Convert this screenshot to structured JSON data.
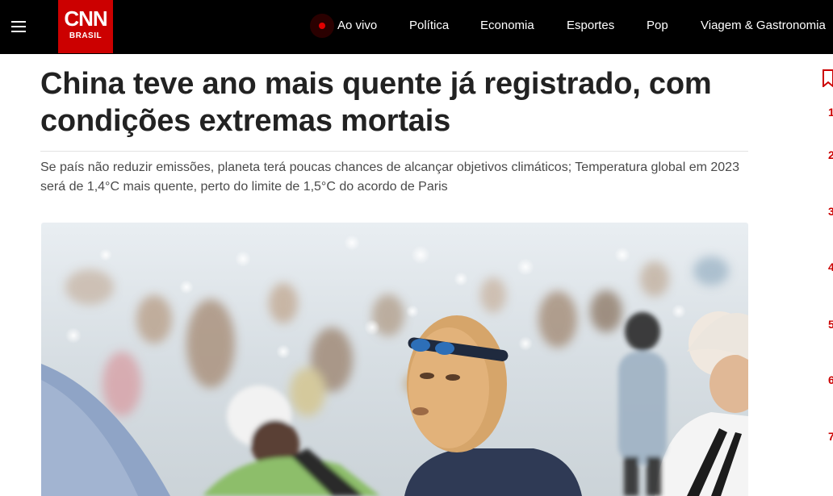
{
  "header": {
    "logo_text": "CNN",
    "logo_sub": "BRASIL",
    "nav": [
      {
        "label": "Ao vivo"
      },
      {
        "label": "Política"
      },
      {
        "label": "Economia"
      },
      {
        "label": "Esportes"
      },
      {
        "label": "Pop"
      },
      {
        "label": "Viagem & Gastronomia"
      }
    ]
  },
  "article": {
    "title": "China teve ano mais quente já registrado, com condições extremas mortais",
    "subtitle": "Se país não reduzir emissões, planeta terá poucas chances de alcançar objetivos climáticos; Temperatura global em 2023 será de 1,4°C mais quente, perto do limite de 1,5°C do acordo de Paris"
  },
  "rail": {
    "numbers": [
      "1",
      "2",
      "3",
      "4",
      "5",
      "6",
      "7"
    ]
  },
  "colors": {
    "brand": "#cc0000",
    "nav_bg": "#000000",
    "headline": "#222222"
  },
  "icons": {
    "menu": "hamburger-icon",
    "live": "live-dot-icon",
    "bookmark": "bookmark-icon"
  }
}
